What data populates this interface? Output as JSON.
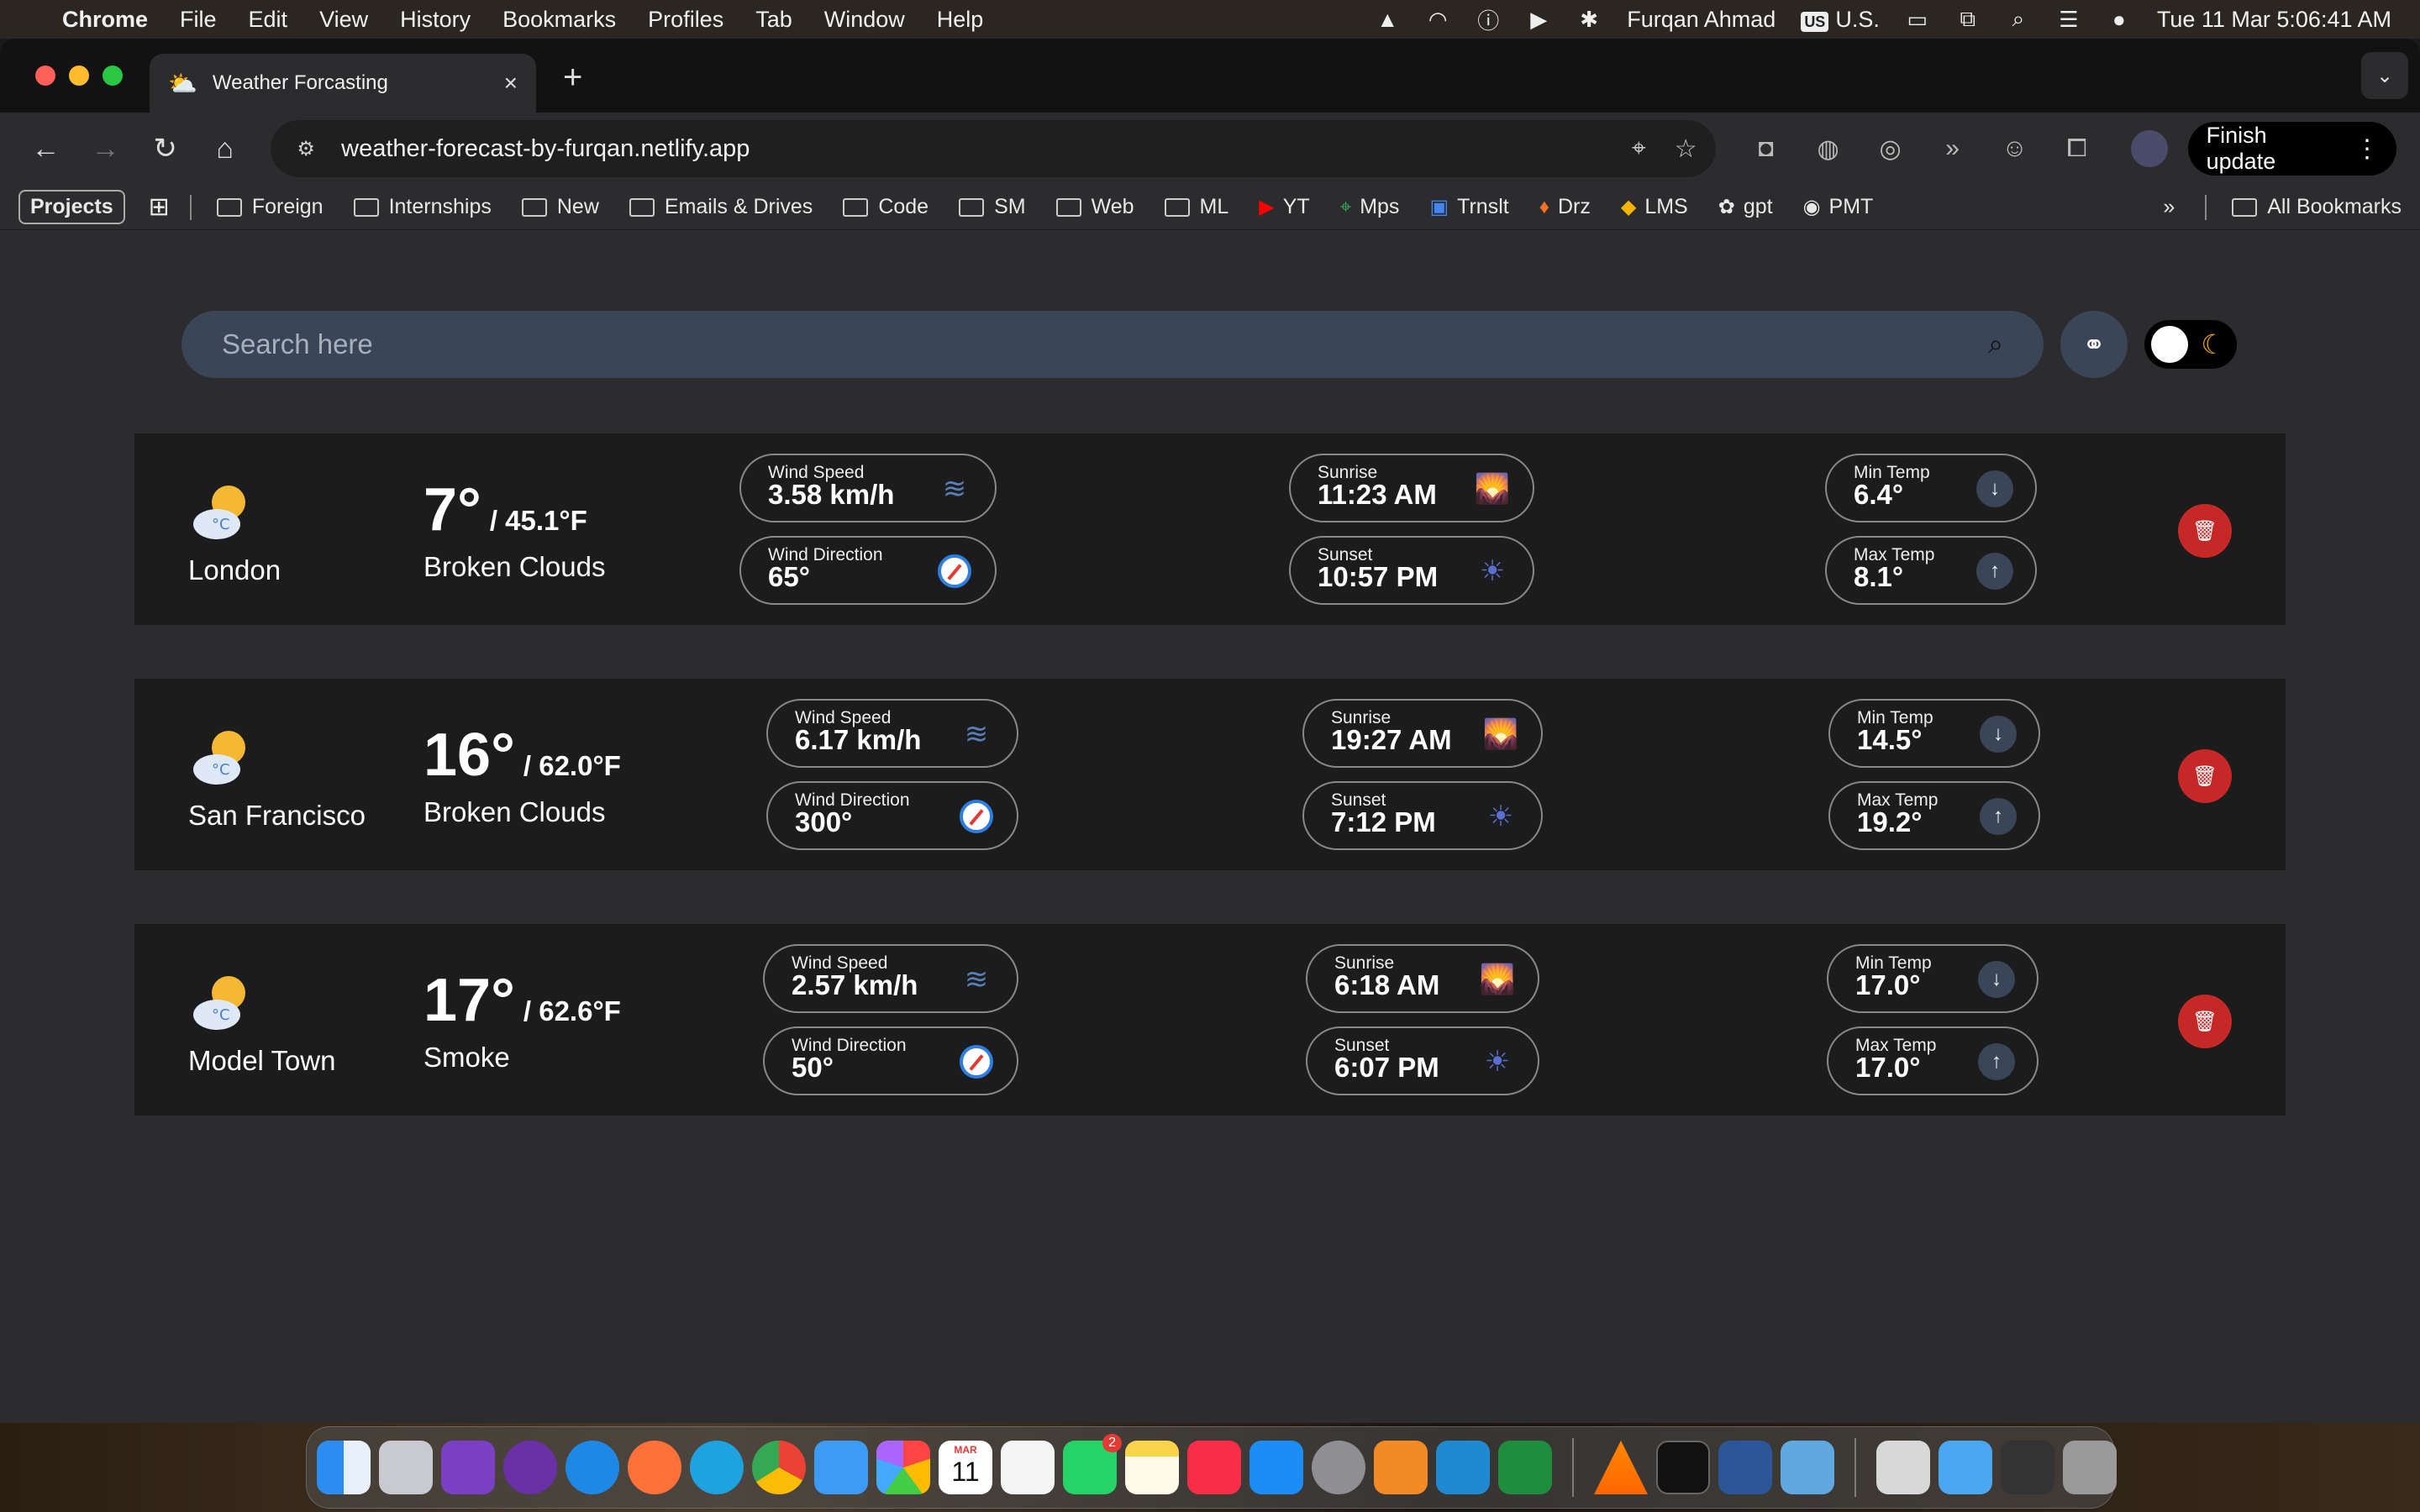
{
  "menubar": {
    "app_name": "Chrome",
    "items": [
      "File",
      "Edit",
      "View",
      "History",
      "Bookmarks",
      "Profiles",
      "Tab",
      "Window",
      "Help"
    ],
    "user": "Furqan Ahmad",
    "input_source_badge": "US",
    "input_source": "U.S.",
    "datetime": "Tue 11 Mar  5:06:41 AM"
  },
  "browser": {
    "tab_title": "Weather Forcasting",
    "url": "weather-forecast-by-furqan.netlify.app",
    "finish_update_label": "Finish update"
  },
  "bookmarks": {
    "projects_label": "Projects",
    "items": [
      "Foreign",
      "Internships",
      "New",
      "Emails & Drives",
      "Code",
      "SM",
      "Web",
      "ML",
      "YT",
      "Mps",
      "Trnslt",
      "Drz",
      "LMS",
      "gpt",
      "PMT"
    ],
    "overflow": "»",
    "all_bookmarks": "All Bookmarks"
  },
  "search": {
    "placeholder": "Search here"
  },
  "cards": [
    {
      "city": "London",
      "temp": "7°",
      "temp_f": "/ 45.1°F",
      "condition": "Broken Clouds",
      "wind_speed_label": "Wind Speed",
      "wind_speed": "3.58 km/h",
      "wind_direction_label": "Wind Direction",
      "wind_direction": "65°",
      "sunrise_label": "Sunrise",
      "sunrise": "11:23 AM",
      "sunset_label": "Sunset",
      "sunset": "10:57 PM",
      "min_label": "Min Temp",
      "min": "6.4°",
      "max_label": "Max Temp",
      "max": "8.1°"
    },
    {
      "city": "San Francisco",
      "temp": "16°",
      "temp_f": "/ 62.0°F",
      "condition": "Broken Clouds",
      "wind_speed_label": "Wind Speed",
      "wind_speed": "6.17 km/h",
      "wind_direction_label": "Wind Direction",
      "wind_direction": "300°",
      "sunrise_label": "Sunrise",
      "sunrise": "19:27 AM",
      "sunset_label": "Sunset",
      "sunset": "7:12 PM",
      "min_label": "Min Temp",
      "min": "14.5°",
      "max_label": "Max Temp",
      "max": "19.2°"
    },
    {
      "city": "Model Town",
      "temp": "17°",
      "temp_f": "/ 62.6°F",
      "condition": "Smoke",
      "wind_speed_label": "Wind Speed",
      "wind_speed": "2.57 km/h",
      "wind_direction_label": "Wind Direction",
      "wind_direction": "50°",
      "sunrise_label": "Sunrise",
      "sunrise": "6:18 AM",
      "sunset_label": "Sunset",
      "sunset": "6:07 PM",
      "min_label": "Min Temp",
      "min": "17.0°",
      "max_label": "Max Temp",
      "max": "17.0°"
    }
  ],
  "dock": {
    "calendar_month": "MAR",
    "calendar_day": "11",
    "whatsapp_badge": "2"
  }
}
